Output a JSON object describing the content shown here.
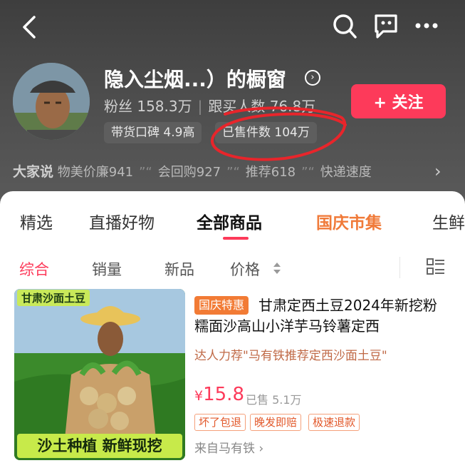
{
  "header": {
    "title": "隐入尘烟...）的橱窗",
    "fans_label": "粉丝",
    "fans_value": "158.3万",
    "buyers_label": "跟买人数",
    "buyers_value": "76.8万",
    "follow_label": "+ 关注",
    "badge_reputation": "带货口碑 4.9高",
    "badge_sold": "已售件数 104万",
    "reviews_title": "大家说",
    "reviews": [
      "物美价廉941",
      "会回购927",
      "推荐618",
      "快递速度"
    ]
  },
  "tabs": [
    "精选",
    "直播好物",
    "全部商品",
    "国庆市集",
    "生鲜"
  ],
  "active_tab": "全部商品",
  "sort": [
    "综合",
    "销量",
    "新品",
    "价格"
  ],
  "product": {
    "image_tag": "甘肃沙面土豆",
    "image_caption": "沙土种植 新鲜现挖",
    "promo": "国庆特惠",
    "title": "甘肃定西土豆2024年新挖粉糯面沙高山小洋芋马铃薯定西",
    "recommend": "达人力荐\"马有铁推荐定西沙面土豆\"",
    "currency": "¥",
    "price": "15.8",
    "sold": "已售 5.1万",
    "services": [
      "坏了包退",
      "晚发即赔",
      "极速退款"
    ],
    "from": "来自马有铁 ›"
  },
  "colors": {
    "accent": "#fd3a5a",
    "festive": "#f07a39",
    "header_bg": "#4a4a4a"
  },
  "icons": [
    "back-icon",
    "search-icon",
    "customer-service-icon",
    "more-icon",
    "chevron-right-icon",
    "sort-arrows-icon",
    "layout-list-icon"
  ]
}
